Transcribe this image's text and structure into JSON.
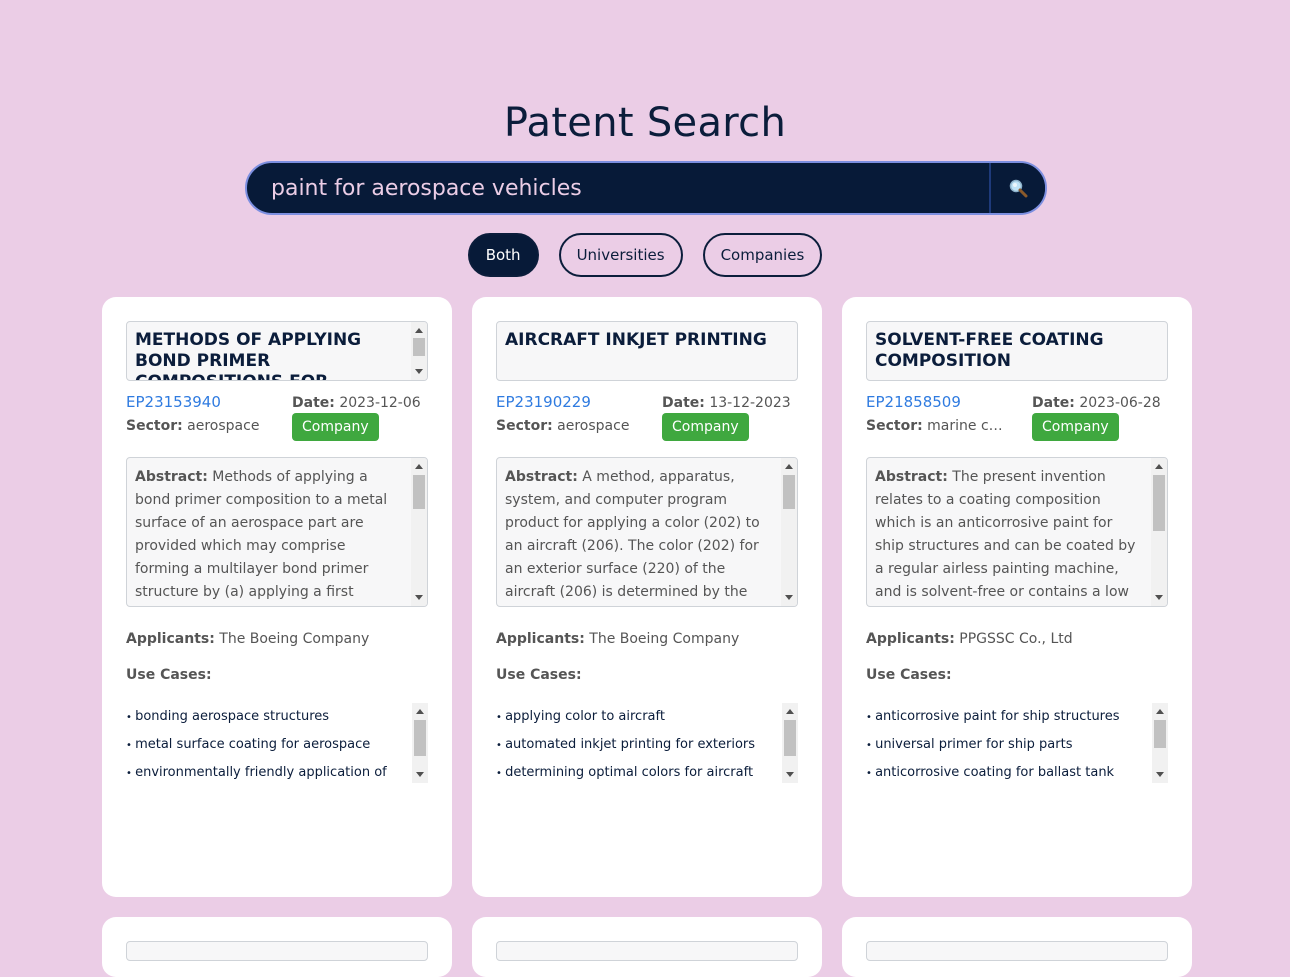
{
  "page": {
    "title": "Patent Search"
  },
  "search": {
    "value": "paint for aerospace vehicles",
    "button_icon": "search-icon"
  },
  "filters": [
    {
      "label": "Both",
      "active": true
    },
    {
      "label": "Universities",
      "active": false
    },
    {
      "label": "Companies",
      "active": false
    }
  ],
  "labels": {
    "date": "Date:",
    "sector": "Sector:",
    "abstract": "Abstract:",
    "applicants": "Applicants:",
    "use_cases": "Use Cases:"
  },
  "colors": {
    "background": "#ebcde6",
    "accent": "#071a38",
    "company_badge": "#3fa83f",
    "link": "#2f7be0"
  },
  "results": [
    {
      "title": "METHODS OF APPLYING BOND PRIMER COMPOSITIONS FOR BONDED AEROSPACE",
      "patent_id": "EP23153940",
      "date": "2023-12-06",
      "sector": "aerospace",
      "badge": "Company",
      "abstract": "Methods of applying a bond primer composition to a metal surface of an aerospace part are provided which may comprise forming a multilayer bond primer structure by (a) applying a first sublayer of a bond",
      "applicants": "The Boeing Company",
      "use_cases": [
        "bonding aerospace structures",
        "metal surface coating for aerospace",
        "environmentally friendly application of"
      ]
    },
    {
      "title": "AIRCRAFT INKJET PRINTING",
      "patent_id": "EP23190229",
      "date": "13-12-2023",
      "sector": "aerospace",
      "badge": "Company",
      "abstract": "A method, apparatus, system, and computer program product for applying a color (202) to an aircraft (206). The color (202) for an exterior surface (220) of the aircraft (206) is determined by the computer",
      "applicants": "The Boeing Company",
      "use_cases": [
        "applying color to aircraft",
        "automated inkjet printing for exteriors",
        "determining optimal colors for aircraft"
      ]
    },
    {
      "title": "SOLVENT-FREE COATING COMPOSITION",
      "patent_id": "EP21858509",
      "date": "2023-06-28",
      "sector": "marine coatings",
      "badge": "Company",
      "abstract": "The present invention relates to a coating composition which is an anticorrosive paint for ship structures and can be coated by a regular airless painting machine, and is solvent-free or contains a low solvent content. The",
      "applicants": "PPGSSC Co., Ltd",
      "use_cases": [
        "anticorrosive paint for ship structures",
        "universal primer for ship parts",
        "anticorrosive coating for ballast tank"
      ]
    }
  ]
}
